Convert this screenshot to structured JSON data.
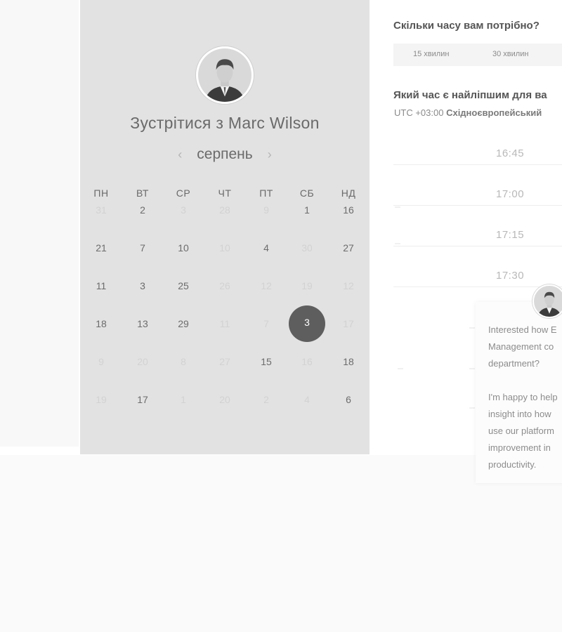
{
  "calendar": {
    "title": "Зустрітися з Marc Wilson",
    "month": "серпень",
    "prev_arrow": "‹",
    "next_arrow": "›",
    "weekdays": [
      "ПН",
      "ВТ",
      "СР",
      "ЧТ",
      "ПТ",
      "СБ",
      "НД"
    ],
    "rows": [
      [
        {
          "t": "31",
          "m": true
        },
        {
          "t": "2",
          "m": false
        },
        {
          "t": "3",
          "m": true
        },
        {
          "t": "28",
          "m": true
        },
        {
          "t": "9",
          "m": true
        },
        {
          "t": "1",
          "m": false
        },
        {
          "t": "16",
          "m": false
        }
      ],
      [
        {
          "t": "21",
          "m": false
        },
        {
          "t": "7",
          "m": false
        },
        {
          "t": "10",
          "m": false
        },
        {
          "t": "10",
          "m": true
        },
        {
          "t": "4",
          "m": false
        },
        {
          "t": "30",
          "m": true
        },
        {
          "t": "27",
          "m": false
        }
      ],
      [
        {
          "t": "11",
          "m": false
        },
        {
          "t": "3",
          "m": false
        },
        {
          "t": "25",
          "m": false
        },
        {
          "t": "26",
          "m": true
        },
        {
          "t": "12",
          "m": true
        },
        {
          "t": "19",
          "m": true
        },
        {
          "t": "12",
          "m": true
        }
      ],
      [
        {
          "t": "18",
          "m": false
        },
        {
          "t": "13",
          "m": false
        },
        {
          "t": "29",
          "m": false
        },
        {
          "t": "11",
          "m": true
        },
        {
          "t": "7",
          "m": true
        },
        {
          "t": "3",
          "m": false,
          "sel": true
        },
        {
          "t": "17",
          "m": true
        }
      ],
      [
        {
          "t": "9",
          "m": true
        },
        {
          "t": "20",
          "m": true
        },
        {
          "t": "8",
          "m": true
        },
        {
          "t": "27",
          "m": true
        },
        {
          "t": "15",
          "m": false
        },
        {
          "t": "16",
          "m": true
        },
        {
          "t": "18",
          "m": false
        }
      ],
      [
        {
          "t": "19",
          "m": true
        },
        {
          "t": "17",
          "m": false
        },
        {
          "t": "1",
          "m": true
        },
        {
          "t": "20",
          "m": true
        },
        {
          "t": "2",
          "m": true
        },
        {
          "t": "4",
          "m": true
        },
        {
          "t": "6",
          "m": false
        }
      ]
    ]
  },
  "booking": {
    "duration_question": "Скільки часу вам потрібно?",
    "durations": [
      "15 хвилин",
      "30 хвилин"
    ],
    "time_question": "Який час є найліпшим для ва",
    "timezone_offset": "UTC +03:00",
    "timezone_name": "Східноєвропейський",
    "slots": [
      "16:45",
      "17:00",
      "17:15",
      "17:30"
    ]
  },
  "chat": {
    "message": "Interested how E\nManagement co\ndepartment?\n\nI'm happy to help\ninsight into how\nuse our platform\nimprovement in \nproductivity."
  },
  "icons": {
    "avatar": "person-portrait-icon",
    "prev": "chevron-left-icon",
    "next": "chevron-right-icon"
  },
  "colors": {
    "panel": "#e2e2e2",
    "selected_day": "#5e5e5e"
  }
}
